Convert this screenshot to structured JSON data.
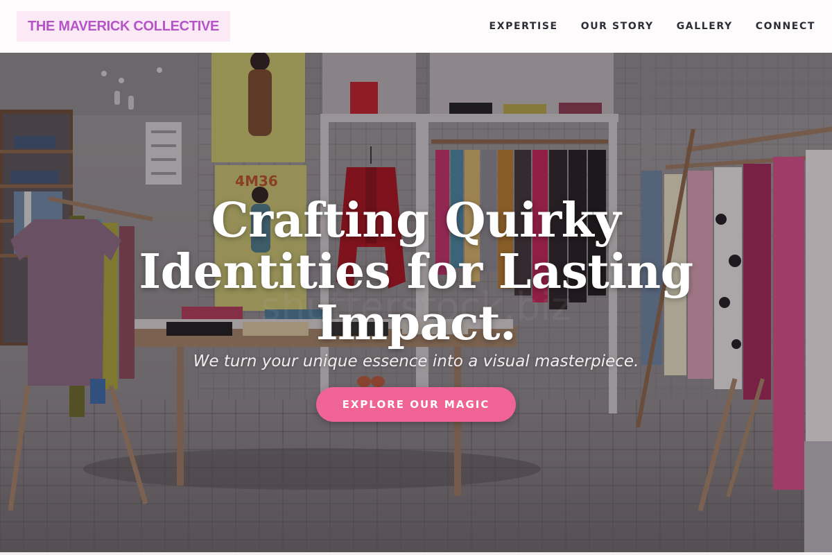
{
  "header": {
    "logo": "THE MAVERICK COLLECTIVE",
    "nav": [
      {
        "label": "EXPERTISE"
      },
      {
        "label": "OUR STORY"
      },
      {
        "label": "GALLERY"
      },
      {
        "label": "CONNECT"
      }
    ]
  },
  "hero": {
    "title_lines": [
      "Crafting Quirky",
      "Identities for Lasting",
      "Impact."
    ],
    "subtitle": "We turn your unique essence into a visual masterpiece.",
    "cta_label": "EXPLORE OUR MAGIC",
    "photo_texts": {
      "poster_code": "4M36",
      "watermark": "shutterstock.biz"
    }
  },
  "colors": {
    "logo_text": "#b454c6",
    "logo_bg": "#fbe9f6",
    "cta_bg": "#ef6494",
    "nav_text": "#2c2c34"
  }
}
